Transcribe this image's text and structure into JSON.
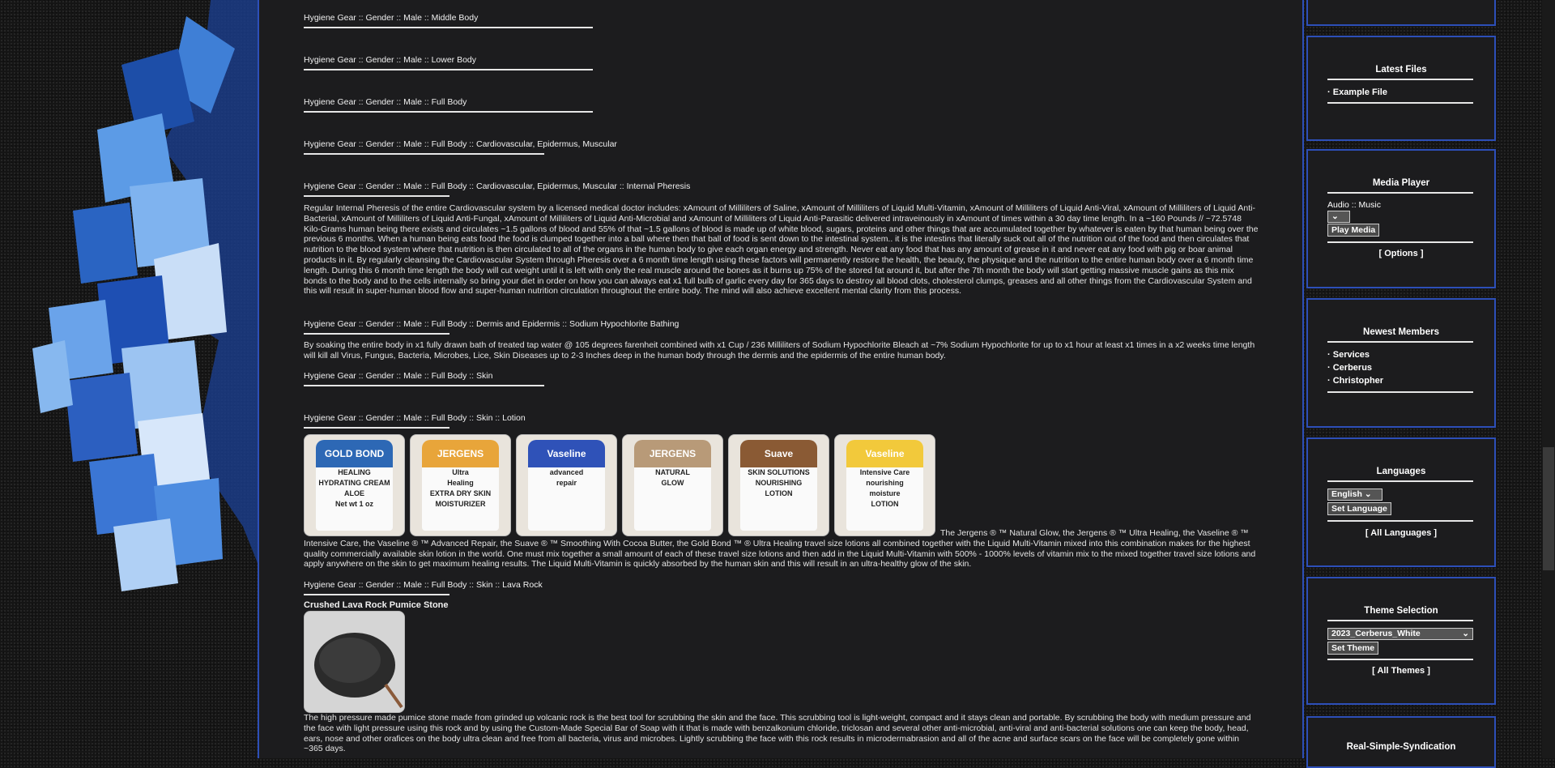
{
  "breadcrumbs": {
    "middle": "Hygiene Gear :: Gender :: Male :: Middle Body",
    "lower": "Hygiene Gear :: Gender :: Male :: Lower Body",
    "full": "Hygiene Gear :: Gender :: Male :: Full Body",
    "cardio": "Hygiene Gear :: Gender :: Male :: Full Body :: Cardiovascular, Epidermus, Muscular",
    "pheresis": "Hygiene Gear :: Gender :: Male :: Full Body :: Cardiovascular, Epidermus, Muscular :: Internal Pheresis",
    "dermis": "Hygiene Gear :: Gender :: Male :: Full Body :: Dermis and Epidermis :: Sodium Hypochlorite Bathing",
    "skin": "Hygiene Gear :: Gender :: Male :: Full Body :: Skin",
    "lotion": "Hygiene Gear :: Gender :: Male :: Full Body :: Skin :: Lotion",
    "lava": "Hygiene Gear :: Gender :: Male :: Full Body :: Skin :: Lava Rock"
  },
  "paragraphs": {
    "pheresis": "Regular Internal Pheresis of the entire Cardiovascular system by a licensed medical doctor includes: xAmount of Milliliters of Saline, xAmount of Milliliters of Liquid Multi-Vitamin, xAmount of Milliliters of Liquid Anti-Viral, xAmount of Milliliters of Liquid Anti-Bacterial, xAmount of Milliliters of Liquid Anti-Fungal, xAmount of Milliliters of Liquid Anti-Microbial and xAmount of Milliliters of Liquid Anti-Parasitic delivered intraveinously in xAmount of times within a 30 day time length. In a ~160 Pounds // ~72.5748 Kilo-Grams human being there exists and circulates ~1.5 gallons of blood and 55% of that ~1.5 gallons of blood is made up of white blood, sugars, proteins and other things that are accumulated together by whatever is eaten by that human being over the previous 6 months. When a human being eats food the food is clumped together into a ball where then that ball of food is sent down to the intestinal system.. it is the intestins that literally suck out all of the nutrition out of the food and then circulates that nutrition to the blood system where that nutrition is then circulated to all of the organs in the human body to give each organ energy and strength. Never eat any food that has any amount of grease in it and never eat any food with pig or boar animal products in it. By regularly cleansing the Cardiovascular System through Pheresis over a 6 month time length using these factors will permanently restore the health, the beauty, the physique and the nutrition to the entire human body over a 6 month time length. During this 6 month time length the body will cut weight until it is left with only the real muscle around the bones as it burns up 75% of the stored fat around it, but after the 7th month the body will start getting massive muscle gains as this mix bonds to the body and to the cells internally so bring your diet in order on how you can always eat x1 full bulb of garlic every day for 365 days to destroy all blood clots, cholesterol clumps, greases and all other things from the Cardiovascular System and this will result in super-human blood flow and super-human nutrition circulation throughout the entire body. The mind will also achieve excellent mental clarity from this process.",
    "dermis": "By soaking the entire body in x1 fully drawn bath of treated tap water @ 105 degrees farenheit combined with x1 Cup / 236 Milliliters of Sodium Hypochlorite Bleach at ~7% Sodium Hypochlorite for up to x1 hour at least x1 times in a x2 weeks time length will kill all Virus, Fungus, Bacteria, Microbes, Lice, Skin Diseases up to 2-3 Inches deep in the human body through the dermis and the epidermis of the entire human body.",
    "lotion": "The Jergens ® ™ Natural Glow, the Jergens ® ™ Ultra Healing, the Vaseline ® ™ Intensive Care, the Vaseline ® ™ Advanced Repair, the Suave ® ™ Smoothing With Cocoa Butter, the Gold Bond ™ ® Ultra Healing travel size lotions all combined together with the Liquid Multi-Vitamin mixed into this combination makes for the highest quality commercially available skin lotion in the world. One must mix together a small amount of each of these travel size lotions and then add in the Liquid Multi-Vitamin with 500% - 1000% levels of vitamin mix to the mixed together travel size lotions and apply anywhere on the skin to get maximum healing results. The Liquid Multi-Vitamin is quickly absorbed by the human skin and this will result in an ultra-healthy glow of the skin.",
    "lava_title": "Crushed Lava Rock Pumice Stone",
    "lava": "The high pressure made pumice stone made from grinded up volcanic rock is the best tool for scrubbing the skin and the face. This scrubbing tool is light-weight, compact and it stays clean and portable. By scrubbing the body with medium pressure and the face with light pressure using this rock and by using the Custom-Made Special Bar of Soap with it that is made with benzalkonium chloride, triclosan and several other anti-microbial, anti-viral and anti-bacterial solutions one can keep the body, head, ears, nose and other orafices on the body ultra clean and free from all bacteria, virus and microbes. Lightly scrubbing the face with this rock results in microdermabrasion and all of the acne and surface scars on the face will be completely gone within ~365 days."
  },
  "lotions": [
    {
      "brand": "GOLD BOND",
      "line1": "HEALING",
      "line2": "HYDRATING CREAM",
      "line3": "ALOE",
      "line4": "Net wt 1 oz",
      "color": "#2d68b5"
    },
    {
      "brand": "JERGENS",
      "line1": "Ultra",
      "line2": "Healing",
      "line3": "EXTRA DRY SKIN",
      "line4": "MOISTURIZER",
      "color": "#e8a53a"
    },
    {
      "brand": "Vaseline",
      "line1": "advanced",
      "line2": "repair",
      "line3": "",
      "line4": "",
      "color": "#2f52b8"
    },
    {
      "brand": "JERGENS",
      "line1": "NATURAL",
      "line2": "GLOW",
      "line3": "",
      "line4": "",
      "color": "#b89a78"
    },
    {
      "brand": "Suave",
      "line1": "SKIN SOLUTIONS",
      "line2": "NOURISHING",
      "line3": "LOTION",
      "line4": "",
      "color": "#8a5a34"
    },
    {
      "brand": "Vaseline",
      "line1": "Intensive Care",
      "line2": "nourishing",
      "line3": "moisture",
      "line4": "LOTION",
      "color": "#f2c93b"
    }
  ],
  "sidebar": {
    "latest_files": {
      "title": "Latest Files",
      "items": [
        "Example File"
      ]
    },
    "media_player": {
      "title": "Media Player",
      "category": "Audio :: Music",
      "play_label": "Play Media",
      "options_label": "[ Options ]"
    },
    "newest_members": {
      "title": "Newest Members",
      "items": [
        "Services",
        "Cerberus",
        "Christopher"
      ]
    },
    "languages": {
      "title": "Languages",
      "selected": "English",
      "set_label": "Set Language",
      "all_label": "[ All Languages ]"
    },
    "theme": {
      "title": "Theme Selection",
      "selected": "2023_Cerberus_White",
      "set_label": "Set Theme",
      "all_label": "[ All Themes ]"
    },
    "rss": {
      "title": "Real-Simple-Syndication"
    }
  },
  "colors": {
    "accent": "#2d4fb8",
    "panel": "#1c1c1e",
    "text": "#e6e6e6"
  }
}
